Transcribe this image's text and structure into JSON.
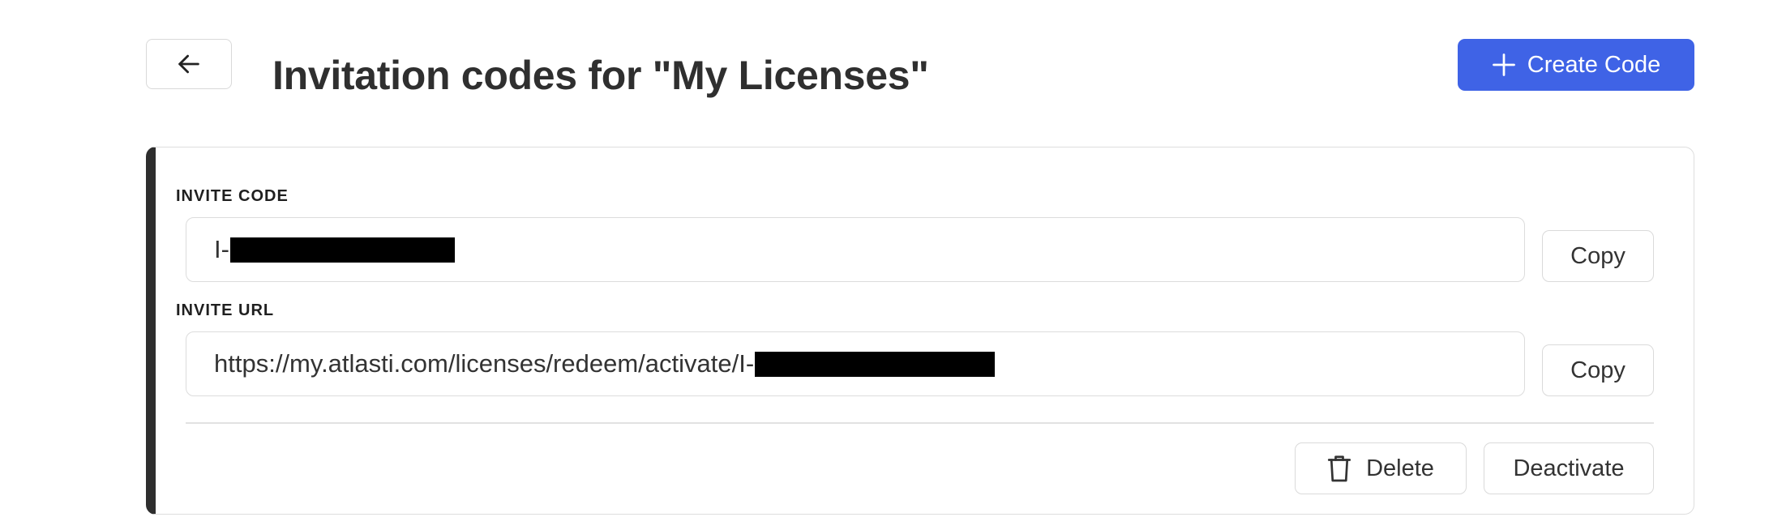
{
  "header": {
    "title": "Invitation codes for \"My Licenses\"",
    "back_icon": "arrow-left-icon",
    "create_button_label": "Create Code",
    "create_button_icon": "plus-icon"
  },
  "invite": {
    "code_label": "INVITE CODE",
    "code_value_prefix": "I-",
    "url_label": "INVITE URL",
    "url_value_prefix": "https://my.atlasti.com/licenses/redeem/activate/I-",
    "copy_label": "Copy"
  },
  "actions": {
    "delete_label": "Delete",
    "delete_icon": "trash-icon",
    "deactivate_label": "Deactivate"
  },
  "colors": {
    "accent": "#3f63e6",
    "card_border_accent": "#2e2e2e",
    "redaction": "#000000"
  }
}
